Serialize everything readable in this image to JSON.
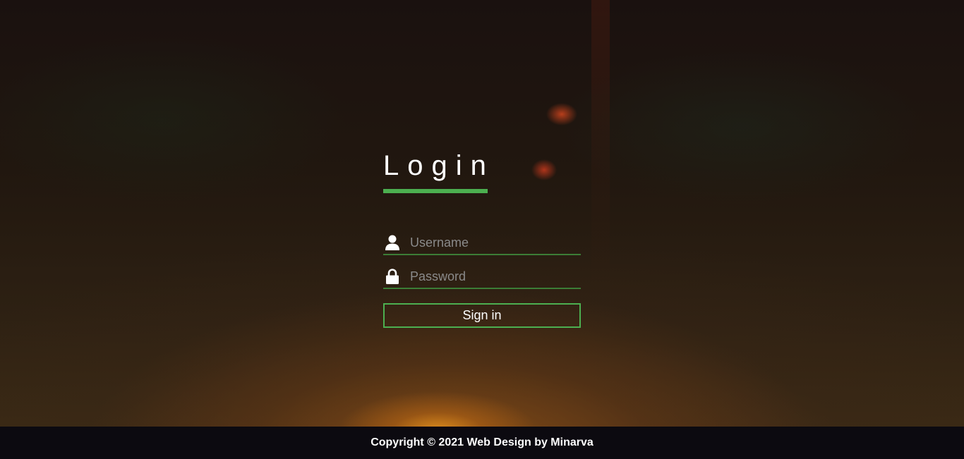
{
  "login": {
    "title": "Login",
    "username": {
      "value": "",
      "placeholder": "Username",
      "icon": "user-icon"
    },
    "password": {
      "value": "",
      "placeholder": "Password",
      "icon": "lock-icon"
    },
    "submit_label": "Sign in"
  },
  "footer": {
    "copyright": "Copyright © 2021 Web Design by Minarva"
  },
  "colors": {
    "accent": "#4caf50",
    "field_underline": "#3c7d36",
    "footer_bg": "#0c0a10"
  }
}
